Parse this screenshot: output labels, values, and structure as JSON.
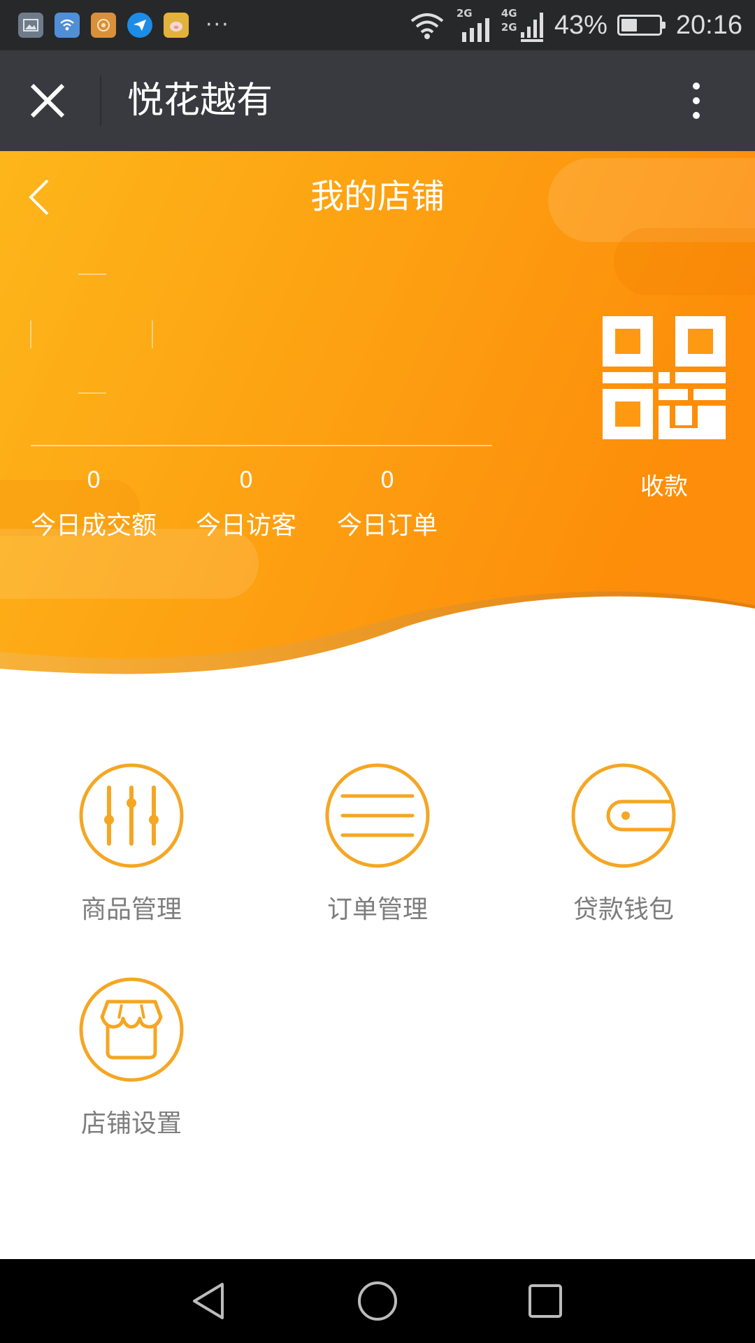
{
  "status_bar": {
    "notification_icons": [
      "gallery-icon",
      "wifi-share-icon",
      "app-icon",
      "message-icon",
      "pig-app-icon"
    ],
    "more": "···",
    "net_label_top": "2G",
    "net_label_mid": "4G",
    "net_label_bottom": "2G",
    "battery_percent_text": "43%",
    "battery_level": 0.43,
    "time": "20:16"
  },
  "title_bar": {
    "title": "悦花越有",
    "close_icon": "close-icon",
    "menu_icon": "more-vertical-icon"
  },
  "header": {
    "page_title": "我的店铺",
    "back_icon": "back-arrow-icon",
    "stats": [
      {
        "value": "0",
        "label": "今日成交额"
      },
      {
        "value": "0",
        "label": "今日访客"
      },
      {
        "value": "0",
        "label": "今日订单"
      }
    ],
    "qr_label": "收款",
    "colors": {
      "orange_light": "#fdb61a",
      "orange_dark": "#fd8d0a"
    }
  },
  "menu": {
    "items": [
      {
        "label": "商品管理",
        "icon": "sliders-icon"
      },
      {
        "label": "订单管理",
        "icon": "list-icon"
      },
      {
        "label": "贷款钱包",
        "icon": "wallet-icon"
      },
      {
        "label": "店铺设置",
        "icon": "storefront-icon"
      }
    ],
    "accent": "#f5a623"
  },
  "nav_bar": {
    "buttons": [
      "back-triangle-icon",
      "home-circle-icon",
      "recents-square-icon"
    ]
  }
}
